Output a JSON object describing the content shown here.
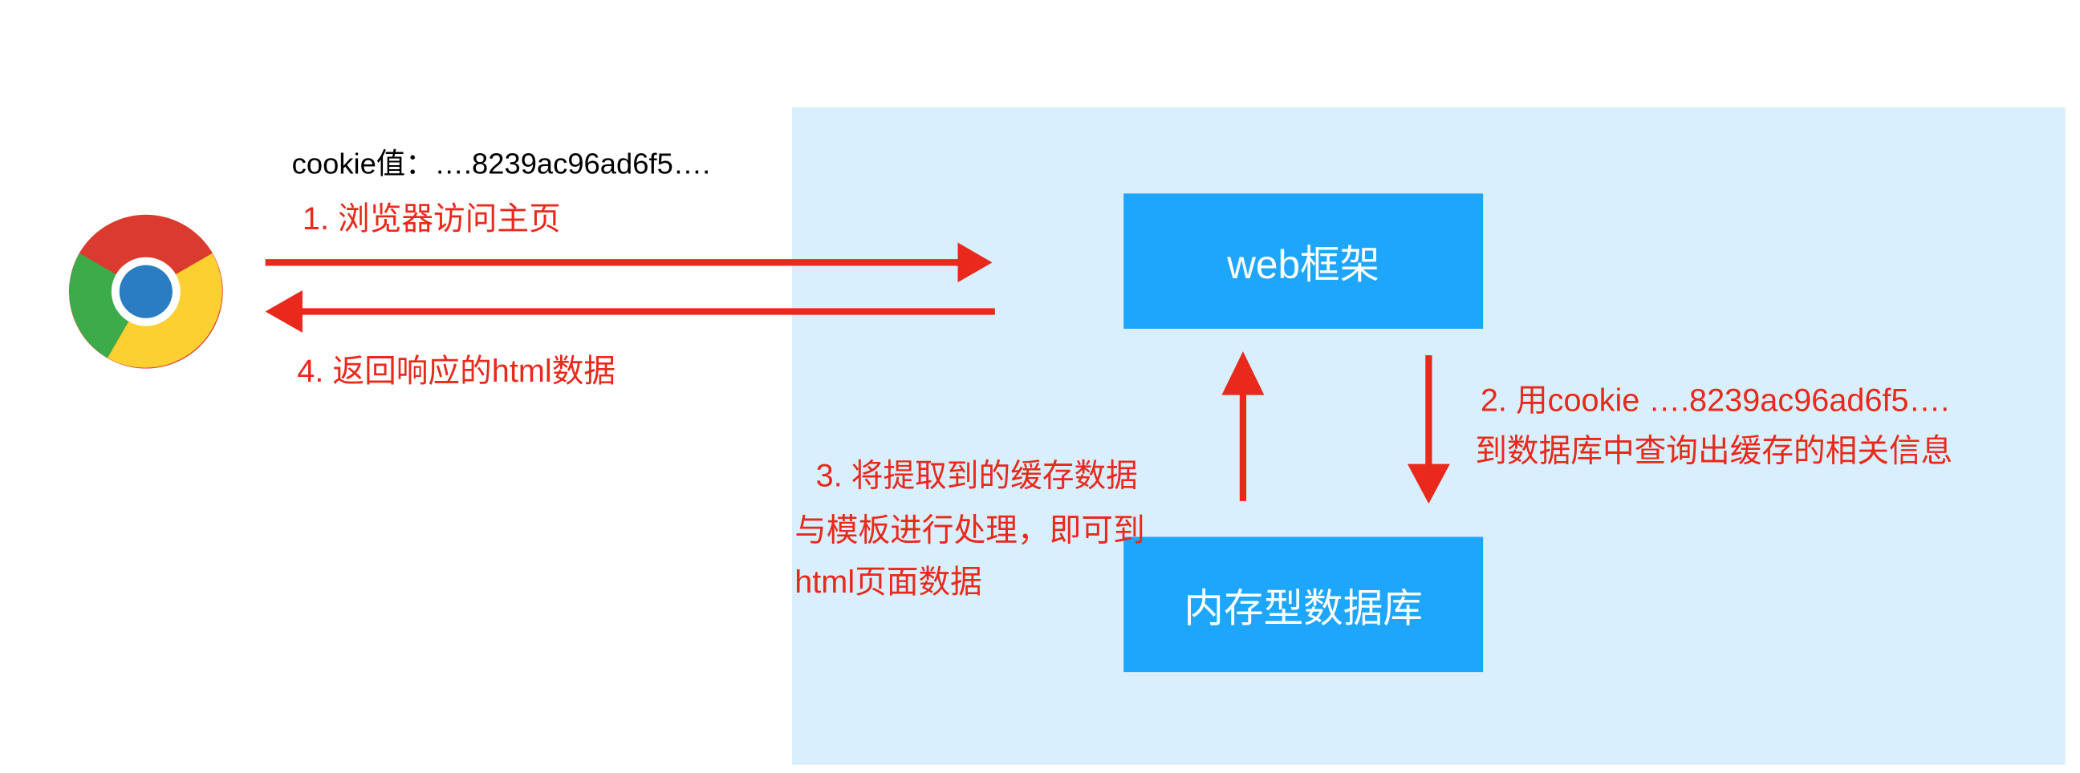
{
  "cookie_label": "cookie值：….8239ac96ad6f5….",
  "steps": {
    "step1": "1. 浏览器访问主页",
    "step2_line1": "2. 用cookie ….8239ac96ad6f5….",
    "step2_line2": "到数据库中查询出缓存的相关信息",
    "step3_line1": "3. 将提取到的缓存数据",
    "step3_line2": "与模板进行处理，即可到",
    "step3_line3": "html页面数据",
    "step4": "4. 返回响应的html数据"
  },
  "boxes": {
    "web": "web框架",
    "db": "内存型数据库"
  },
  "colors": {
    "box": "#1ea5fc",
    "zone": "#daeffd",
    "arrow": "#e8291c"
  }
}
